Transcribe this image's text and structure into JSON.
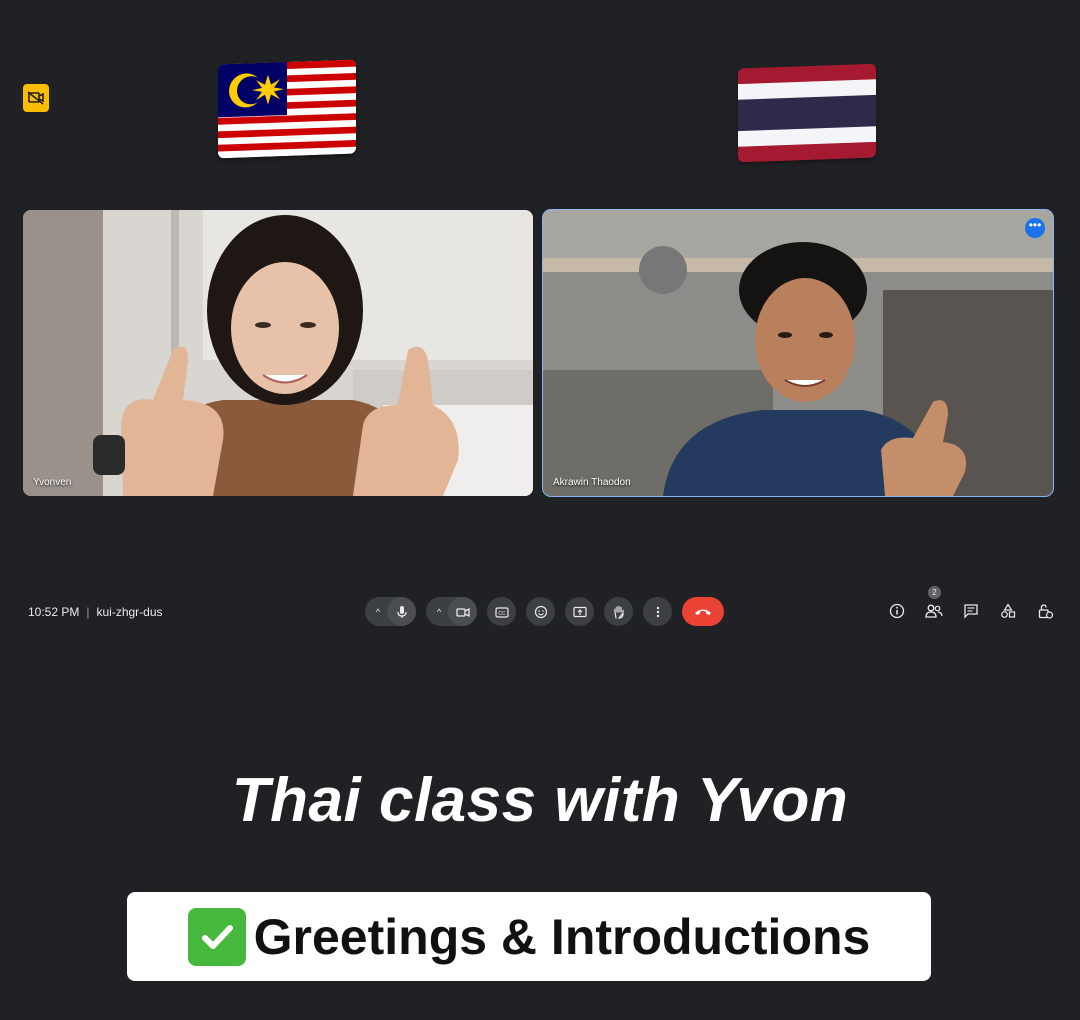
{
  "meeting": {
    "time": "10:52 PM",
    "code": "kui-zhgr-dus"
  },
  "participants": [
    {
      "name": "Yvonven"
    },
    {
      "name": "Akrawin Thaodon"
    }
  ],
  "people_count": "2",
  "tile_menu_icon": "more-horiz-icon",
  "controls": [
    "mic-icon",
    "camera-icon",
    "captions-icon",
    "emoji-icon",
    "present-icon",
    "raise-hand-icon",
    "more-vert-icon",
    "hangup-icon"
  ],
  "side_controls": [
    "info-icon",
    "people-icon",
    "chat-icon",
    "activities-icon",
    "host-controls-icon"
  ],
  "overlay": {
    "headline": "Thai class with Yvon",
    "topic": "Greetings & Introductions"
  },
  "colors": {
    "background": "#202124",
    "active_tile_border": "#8ab4f8",
    "hangup": "#ea4335",
    "badge": "#fbbc04"
  }
}
